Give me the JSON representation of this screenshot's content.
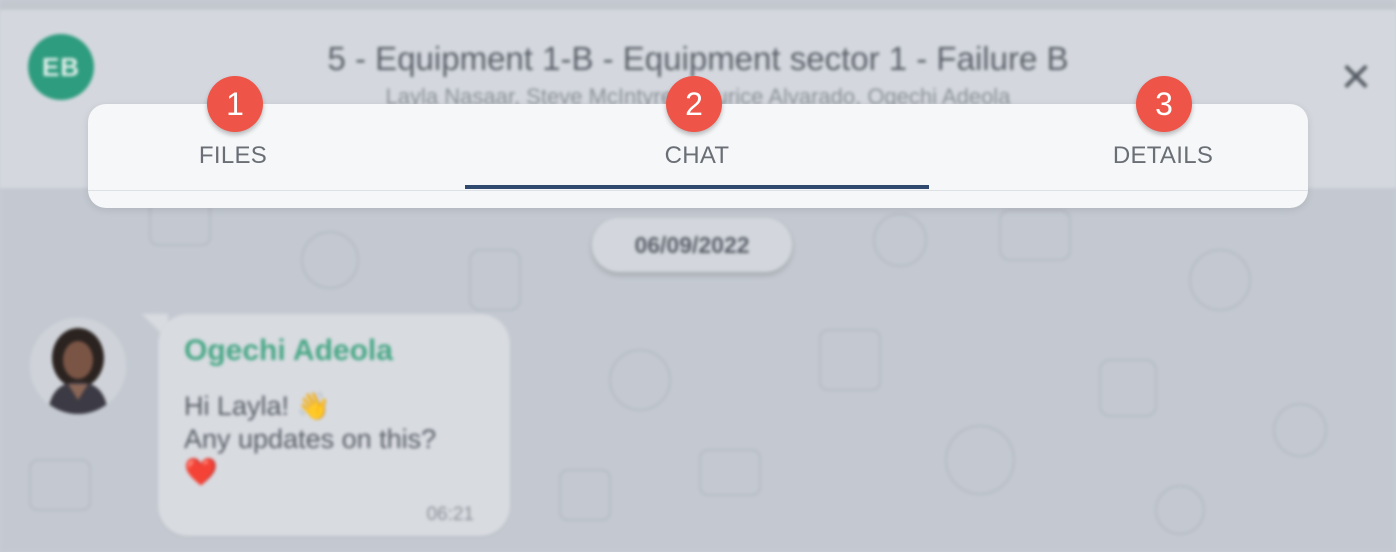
{
  "header": {
    "avatar_initials": "EB",
    "title": "5 - Equipment 1-B - Equipment sector 1 - Failure B",
    "members": "Layla Nasaar, Steve McIntyre, Maurice Alvarado, Ogechi Adeola",
    "close_icon": "close-icon"
  },
  "tabs": [
    {
      "label": "FILES",
      "badge": "1",
      "active": false
    },
    {
      "label": "CHAT",
      "badge": "2",
      "active": true
    },
    {
      "label": "DETAILS",
      "badge": "3",
      "active": false
    }
  ],
  "chat": {
    "date": "06/09/2022",
    "message": {
      "sender": "Ogechi Adeola",
      "line1": "Hi Layla! 👋",
      "line2": "Any updates on this?",
      "line3": "❤️",
      "time": "06:21"
    }
  },
  "colors": {
    "accent": "#2f4a6e",
    "badge": "#ee5447",
    "sender_name": "#4aa887",
    "avatar_bg": "#2e9c7e"
  }
}
